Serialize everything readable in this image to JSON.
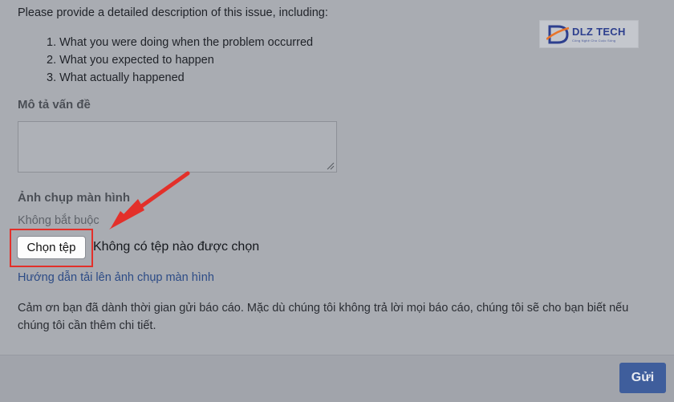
{
  "form": {
    "intro": "Please provide a detailed description of this issue, including:",
    "steps": [
      "1. What you were doing when the problem occurred",
      "2. What you expected to happen",
      "3. What actually happened"
    ],
    "description_label": "Mô tả vấn đề",
    "description_value": "",
    "screenshot_label": "Ảnh chụp màn hình",
    "optional_label": "Không bắt buộc",
    "choose_file_label": "Chọn tệp",
    "no_file_text": "Không có tệp nào được chọn",
    "help_link": "Hướng dẫn tải lên ảnh chụp màn hình",
    "thanks_text": "Cảm ơn bạn đã dành thời gian gửi báo cáo. Mặc dù chúng tôi không trả lời mọi báo cáo, chúng tôi sẽ cho bạn biết nếu chúng tôi cần thêm chi tiết."
  },
  "footer": {
    "send_label": "Gửi"
  },
  "watermark": {
    "brand": "DLZ TECH",
    "tagline": "Công Nghệ Cho Cuộc Sống"
  },
  "colors": {
    "annotation": "#e3302a",
    "primary_button": "#3f5e9c",
    "link": "#2c4b86"
  }
}
